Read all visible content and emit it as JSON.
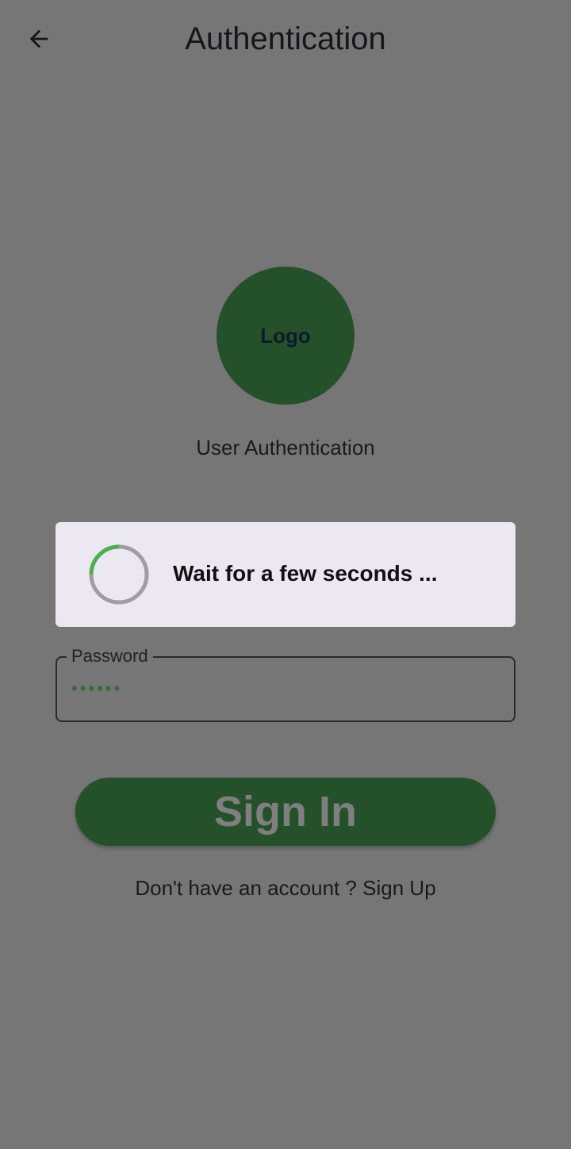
{
  "header": {
    "title": "Authentication",
    "back_icon": "arrow-back-icon"
  },
  "logo": {
    "label": "Logo",
    "color": "#245129"
  },
  "subtitle": "User Authentication",
  "dialog": {
    "message": "Wait for a few seconds ...",
    "spinner_color": "#4caf50"
  },
  "password": {
    "label": "Password",
    "value": "••••••"
  },
  "signin": {
    "label": "Sign In"
  },
  "signup": {
    "text": "Don't have an account ? Sign Up"
  },
  "colors": {
    "background_overlay": "#767676",
    "accent_green": "#245129",
    "dialog_background": "#ebe8f2"
  }
}
